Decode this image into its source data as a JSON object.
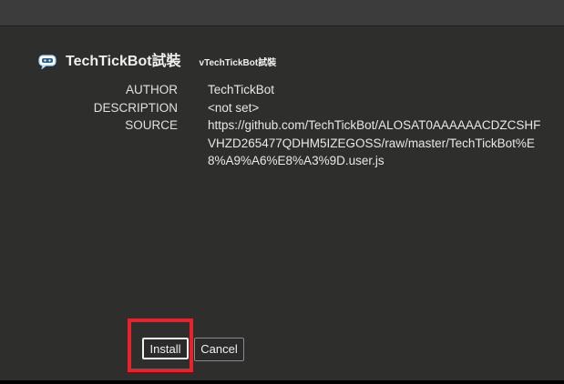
{
  "script": {
    "name": "TechTickBot試裝",
    "version": "vTechTickBot試裝",
    "icon": "speech-bubble-icon"
  },
  "metadata": [
    {
      "key": "AUTHOR",
      "value": "TechTickBot"
    },
    {
      "key": "DESCRIPTION",
      "value": "<not set>"
    },
    {
      "key": "SOURCE",
      "value": "https://github.com/TechTickBot/ALOSAT0AAAAAACDZCSHFVHZD265477QDHM5IZEGOSS/raw/master/TechTickBot%E8%A9%A6%E8%A3%9D.user.js"
    }
  ],
  "buttons": {
    "install_label": "Install",
    "cancel_label": "Cancel"
  },
  "colors": {
    "background": "#2e2e2c",
    "topbar": "#3c3c3c",
    "highlight": "#e8222a"
  }
}
